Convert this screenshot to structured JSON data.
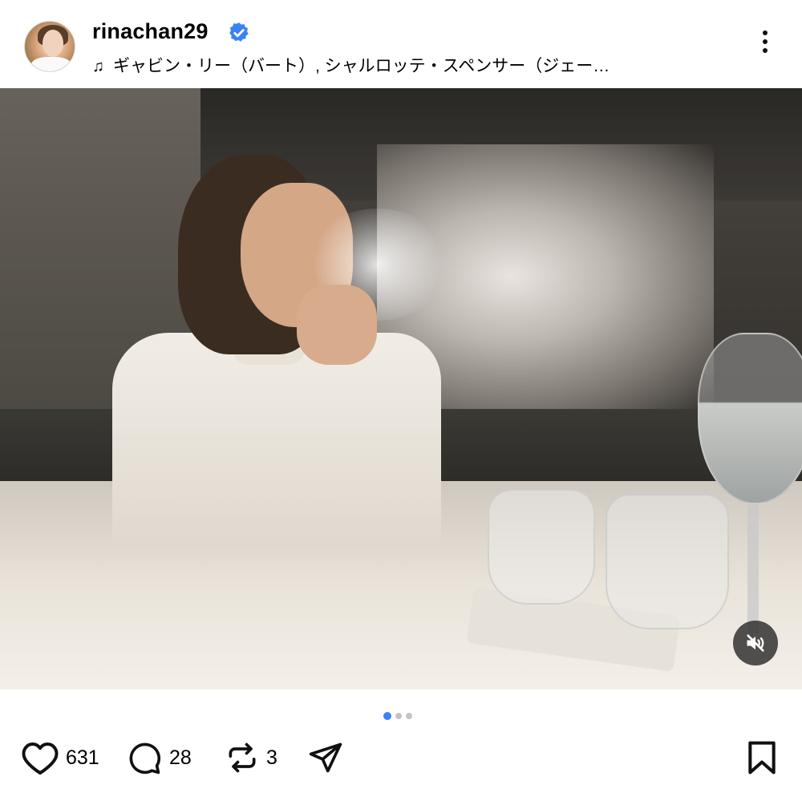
{
  "post": {
    "username": "rinachan29",
    "verified": true,
    "music": "ギャビン・リー（バート）, シャルロッテ・スペンサー（ジェー…",
    "icons": {
      "verified": "verified-badge-icon",
      "music": "music-note-icon",
      "more": "more-options-icon"
    }
  },
  "media": {
    "carousel": {
      "count": 3,
      "active": 1
    },
    "mute_icon": "muted-speaker-icon"
  },
  "actions": {
    "likes": "631",
    "comments": "28",
    "reposts": "3",
    "icons": [
      "heart-icon",
      "comment-icon",
      "repost-icon",
      "share-icon",
      "bookmark-icon"
    ]
  },
  "colors": {
    "verified": "#3b82f6",
    "active_dot": "#3b82f6",
    "inactive_dot": "#c4c4c4"
  }
}
